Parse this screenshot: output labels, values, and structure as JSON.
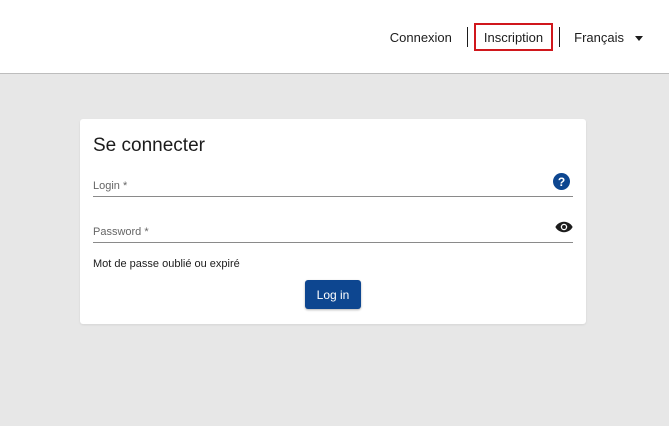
{
  "header": {
    "links": {
      "connexion": "Connexion",
      "inscription": "Inscription"
    },
    "language": "Français",
    "highlight_color": "#d0171c"
  },
  "login_card": {
    "title": "Se connecter",
    "login_label": "Login *",
    "password_label": "Password *",
    "help_icon": "question-mark-icon",
    "visibility_icon": "eye-icon",
    "forgot_link": "Mot de passe oublié ou expiré",
    "submit_label": "Log in",
    "accent_color": "#0d4690"
  }
}
